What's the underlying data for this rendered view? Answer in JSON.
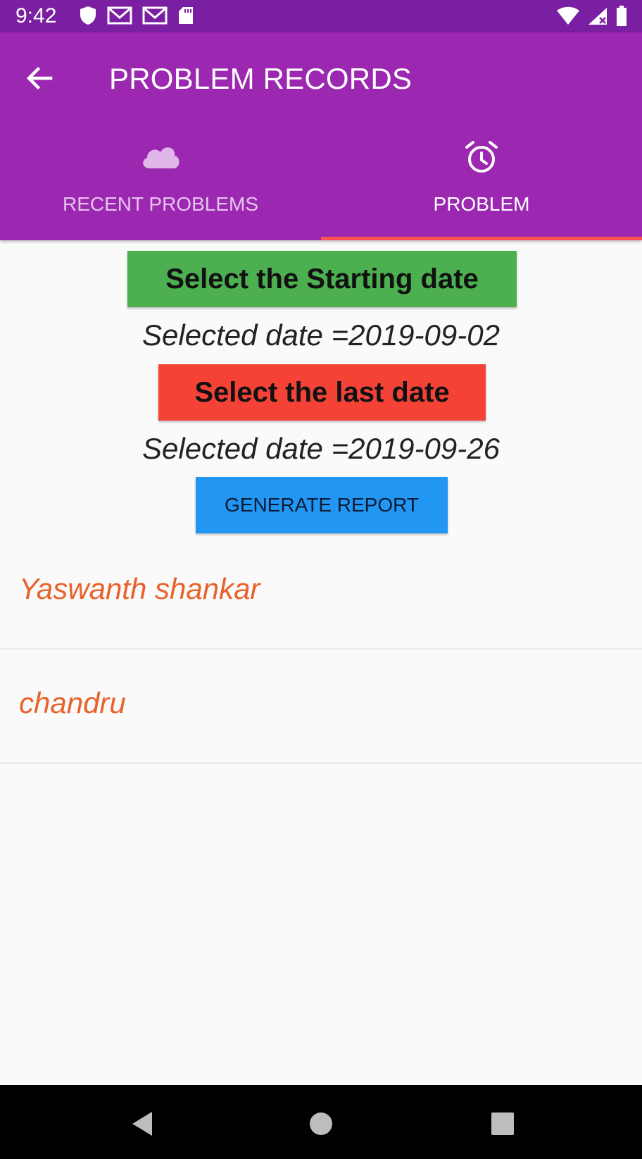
{
  "status_bar": {
    "time": "9:42",
    "left_icons": [
      "shield-icon",
      "gmail-icon",
      "gmail-icon",
      "sd-card-icon"
    ],
    "right_icons": [
      "wifi-icon",
      "signal-icon",
      "battery-icon"
    ]
  },
  "app_bar": {
    "title": "PROBLEM RECORDS",
    "back_icon": "arrow-left-icon",
    "color": "#9c27b0"
  },
  "tabs": [
    {
      "label": "RECENT PROBLEMS",
      "icon": "cloud-icon",
      "selected": false
    },
    {
      "label": "PROBLEM",
      "icon": "alarm-clock-icon",
      "selected": true
    }
  ],
  "form": {
    "start_button_label": "Select the Starting date",
    "start_date_text": "Selected date =2019-09-02",
    "end_button_label": "Select the last date",
    "end_date_text": "Selected date =2019-09-26",
    "report_button_label": "GENERATE REPORT",
    "colors": {
      "start": "#4caf50",
      "end": "#f44336",
      "report": "#2196f3"
    }
  },
  "list": {
    "items": [
      "Yaswanth shankar",
      "chandru"
    ],
    "text_color": "#e8622c"
  },
  "nav_bar": {
    "icons": [
      "back-triangle-icon",
      "home-circle-icon",
      "recents-square-icon"
    ]
  }
}
